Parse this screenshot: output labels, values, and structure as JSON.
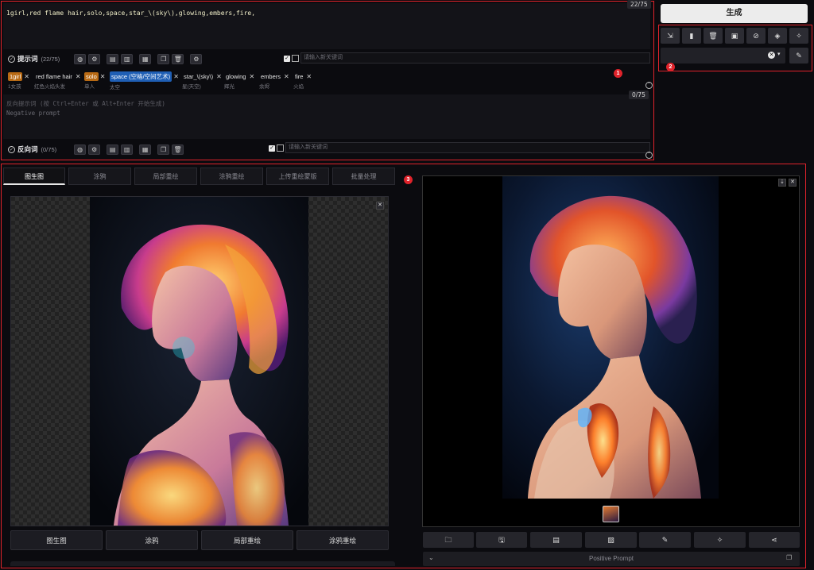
{
  "positive": {
    "text": "1girl,red flame hair,solo,space,star_\\(sky\\),glowing,embers,fire,",
    "counter": "22/75",
    "label": "提示词",
    "count": "(22/75)",
    "kw_placeholder": "请输入新关键词"
  },
  "tags": [
    {
      "main": "1girl",
      "sub": "1女孩",
      "style": "orange"
    },
    {
      "main": "red flame hair",
      "sub": "红色火焰头发",
      "style": "plain"
    },
    {
      "main": "solo",
      "sub": "单人",
      "style": "orange"
    },
    {
      "main": "space (空格/空间艺术)",
      "sub": "太空",
      "style": "blue"
    },
    {
      "main": "star_\\(sky\\)",
      "sub": "星(天空)",
      "style": "plain"
    },
    {
      "main": "glowing",
      "sub": "辉光",
      "style": "plain"
    },
    {
      "main": "embers",
      "sub": "余烬",
      "style": "plain"
    },
    {
      "main": "fire",
      "sub": "火焰",
      "style": "plain"
    }
  ],
  "negative": {
    "placeholder_line1": "反向提示词 (按 Ctrl+Enter 或 Alt+Enter 开始生成)",
    "placeholder_line2": "Negative prompt",
    "counter": "0/75",
    "label": "反向词",
    "count": "(0/75)",
    "kw_placeholder": "请输入新关键词"
  },
  "generate": {
    "label": "生成"
  },
  "tool_icons": [
    "arrow-diagonal-icon",
    "book-icon",
    "trash-icon",
    "clipboard-icon",
    "paperclip-icon",
    "cube-icon",
    "magic-wand-icon"
  ],
  "badges": {
    "one": "1",
    "two": "2",
    "three": "3"
  },
  "tabs": [
    {
      "label": "图生图",
      "active": true
    },
    {
      "label": "涂鸦",
      "active": false
    },
    {
      "label": "局部重绘",
      "active": false
    },
    {
      "label": "涂鸦重绘",
      "active": false
    },
    {
      "label": "上传重绘蒙版",
      "active": false
    },
    {
      "label": "批量处理",
      "active": false
    }
  ],
  "copy_buttons": [
    "图生图",
    "涂鸦",
    "局部重绘",
    "涂鸦重绘"
  ],
  "output_buttons": [
    "folder-icon",
    "save-icon",
    "zip-icon",
    "image-icon",
    "brush-icon",
    "magic-icon",
    "share-icon"
  ],
  "positive_prompt_bar": {
    "label": "Positive Prompt"
  },
  "colors": {
    "accent_red": "#e0232b",
    "tag_orange": "#b86a14",
    "tag_blue": "#1f5fb5"
  }
}
